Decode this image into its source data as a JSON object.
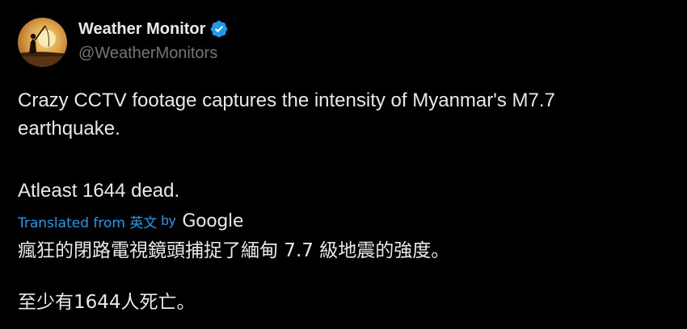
{
  "author": {
    "display_name": "Weather Monitor",
    "handle": "@WeatherMonitors",
    "verified": true,
    "avatar": "silhouette-sunset-avatar"
  },
  "post": {
    "line1": "Crazy CCTV footage captures the intensity of Myanmar's M7.7",
    "line2": "earthquake.",
    "line3": "Atleast 1644 dead."
  },
  "translation": {
    "from_label": "Translated from 英文",
    "by_label": "by",
    "provider": "Google",
    "line1": "瘋狂的閉路電視鏡頭捕捉了緬甸 7.7 級地震的強度。",
    "line2": "至少有1644人死亡。"
  },
  "colors": {
    "background": "#000000",
    "text": "#e7e9ea",
    "muted": "#71767b",
    "accent": "#1d9bf0"
  }
}
